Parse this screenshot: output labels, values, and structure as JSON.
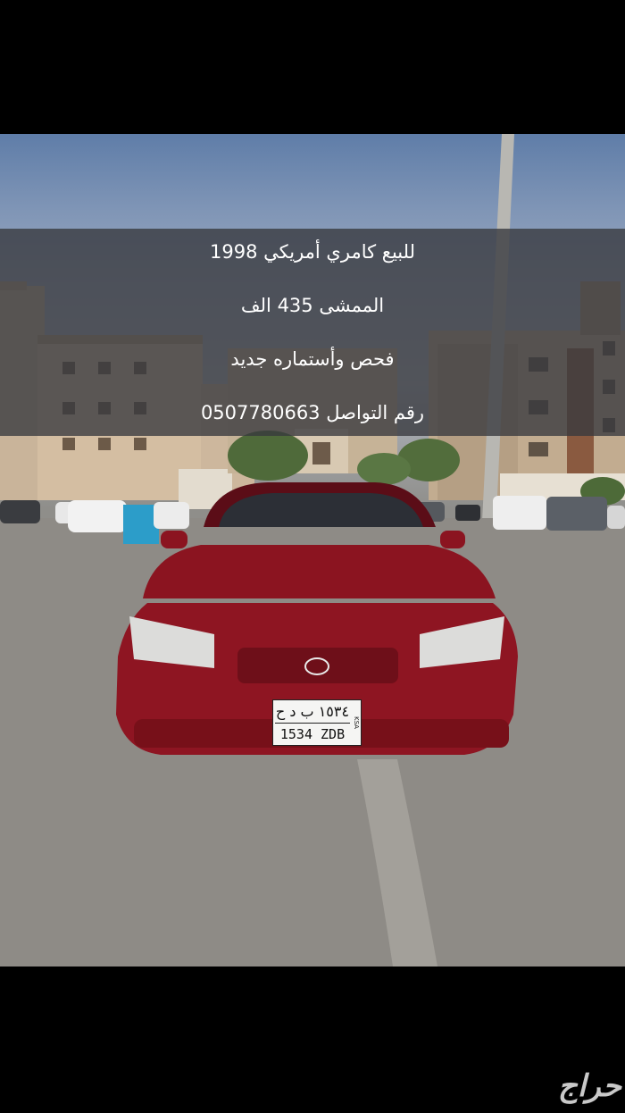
{
  "listing": {
    "line1": "للبيع كامري أمريكي 1998",
    "line2": "الممشى 435 الف",
    "line3": "فحص وأستماره جديد",
    "line4": "رقم التواصل 0507780663"
  },
  "plate": {
    "arabic_top": "١٥٣٤ ب د ح",
    "latin_bottom": "1534 ZDB",
    "side": "KSA"
  },
  "watermark": {
    "text": "حراج"
  },
  "colors": {
    "background": "#000000",
    "overlay": "#37393e",
    "car": "#8b1420"
  }
}
